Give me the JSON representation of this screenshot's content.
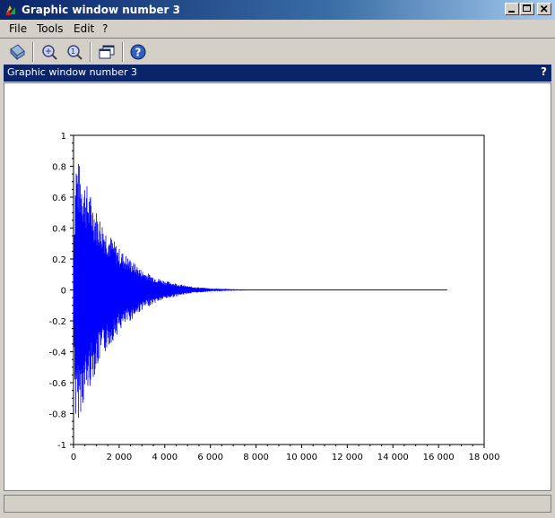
{
  "window": {
    "title": "Graphic window number 3",
    "buttons": [
      "minimize",
      "maximize",
      "close"
    ]
  },
  "menubar": {
    "items": [
      "File",
      "Tools",
      "Edit",
      "?"
    ]
  },
  "toolbar": {
    "icons": [
      "rotate-icon",
      "zoom-icon",
      "zoom-reset-icon",
      "windows-icon",
      "help-icon"
    ]
  },
  "dock": {
    "title": "Graphic window number 3",
    "help": "?"
  },
  "colors": {
    "signal": "#0000ff",
    "dock_bar": "#0a246a"
  },
  "chart_data": {
    "type": "line",
    "title": "",
    "xlabel": "",
    "ylabel": "",
    "xlim": [
      0,
      18000
    ],
    "ylim": [
      -1,
      1
    ],
    "x_ticks": [
      "0",
      "2 000",
      "4 000",
      "6 000",
      "8 000",
      "10 000",
      "12 000",
      "14 000",
      "16 000",
      "18 000"
    ],
    "y_ticks": [
      "1",
      "0.8",
      "0.6",
      "0.4",
      "0.2",
      "0",
      "-0.2",
      "-0.4",
      "-0.6",
      "-0.8",
      "-1"
    ],
    "grid": false,
    "series": [
      {
        "color": "#0000ff",
        "description": "exponentially decaying oscillation",
        "envelope": {
          "x": [
            0,
            100,
            250,
            500,
            1000,
            1500,
            2000,
            2500,
            3000,
            3500,
            4000,
            5000,
            6000,
            7000,
            8000,
            10000,
            16384
          ],
          "amplitude": [
            0.2,
            0.9,
            0.82,
            0.72,
            0.52,
            0.38,
            0.27,
            0.2,
            0.13,
            0.09,
            0.06,
            0.025,
            0.01,
            0.005,
            0.002,
            0.0,
            0.0
          ]
        },
        "x_end": 16384
      }
    ]
  }
}
